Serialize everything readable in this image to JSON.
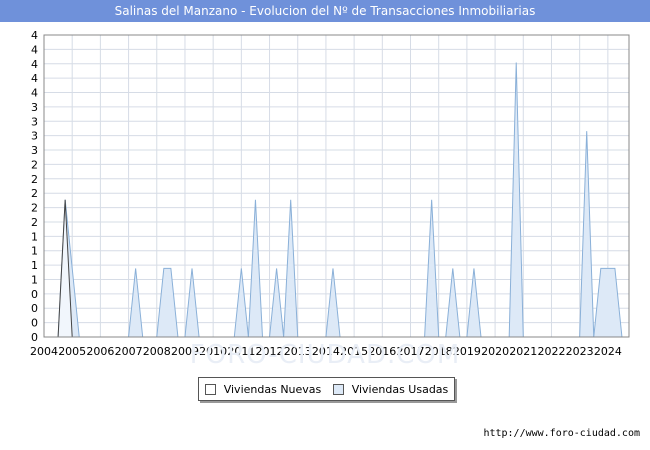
{
  "header": {
    "title": "Salinas del Manzano - Evolucion del Nº de Transacciones Inmobiliarias",
    "background": "#6f91da"
  },
  "footer": {
    "source": "http://www.foro-ciudad.com"
  },
  "watermark": "FORO-CIUDAD.COM",
  "chart_data": {
    "type": "area",
    "title": "Salinas del Manzano - Evolucion del Nº de Transacciones Inmobiliarias",
    "xlabel": "",
    "ylabel": "",
    "x_ticks": [
      "2004",
      "2005",
      "2006",
      "2007",
      "2008",
      "2009",
      "2010",
      "2011",
      "2012",
      "2013",
      "2014",
      "2015",
      "2016",
      "2017",
      "2018",
      "2019",
      "2020",
      "2021",
      "2022",
      "2023",
      "2024"
    ],
    "y_ticks": [
      "0",
      "0",
      "0",
      "0",
      "1",
      "1",
      "1",
      "1",
      "2",
      "2",
      "2",
      "2",
      "2",
      "3",
      "3",
      "3",
      "3",
      "4",
      "4",
      "4",
      "4",
      "4"
    ],
    "xlim": [
      2004,
      2024.75
    ],
    "ylim": [
      0,
      4.4
    ],
    "grid": true,
    "legend_position": "bottom",
    "series": [
      {
        "name": "Viviendas Nuevas",
        "color": "#ffffff",
        "stroke": "#444444",
        "points": [
          [
            2004.5,
            0
          ],
          [
            2004.75,
            2
          ],
          [
            2005,
            0
          ]
        ]
      },
      {
        "name": "Viviendas Usadas",
        "color": "#dde9f7",
        "stroke": "#8ab0d8",
        "points": [
          [
            2004.5,
            0
          ],
          [
            2004.75,
            2
          ],
          [
            2005,
            1
          ],
          [
            2005.25,
            0
          ],
          [
            2007,
            0
          ],
          [
            2007.25,
            1
          ],
          [
            2007.5,
            0
          ],
          [
            2008,
            0
          ],
          [
            2008.25,
            1
          ],
          [
            2008.5,
            1
          ],
          [
            2008.75,
            0
          ],
          [
            2009,
            0
          ],
          [
            2009.25,
            1
          ],
          [
            2009.5,
            0
          ],
          [
            2010.75,
            0
          ],
          [
            2011,
            1
          ],
          [
            2011.25,
            0
          ],
          [
            2011.5,
            2
          ],
          [
            2011.75,
            0
          ],
          [
            2012,
            0
          ],
          [
            2012.25,
            1
          ],
          [
            2012.5,
            0
          ],
          [
            2012.75,
            2
          ],
          [
            2013,
            0
          ],
          [
            2014,
            0
          ],
          [
            2014.25,
            1
          ],
          [
            2014.5,
            0
          ],
          [
            2017.5,
            0
          ],
          [
            2017.75,
            2
          ],
          [
            2018,
            0
          ],
          [
            2018.25,
            0
          ],
          [
            2018.5,
            1
          ],
          [
            2018.75,
            0
          ],
          [
            2019,
            0
          ],
          [
            2019.25,
            1
          ],
          [
            2019.5,
            0
          ],
          [
            2020.5,
            0
          ],
          [
            2020.75,
            4
          ],
          [
            2021,
            0
          ],
          [
            2023,
            0
          ],
          [
            2023.25,
            3
          ],
          [
            2023.5,
            0
          ],
          [
            2023.75,
            1
          ],
          [
            2024,
            1
          ],
          [
            2024.25,
            1
          ],
          [
            2024.5,
            0
          ]
        ]
      }
    ]
  }
}
